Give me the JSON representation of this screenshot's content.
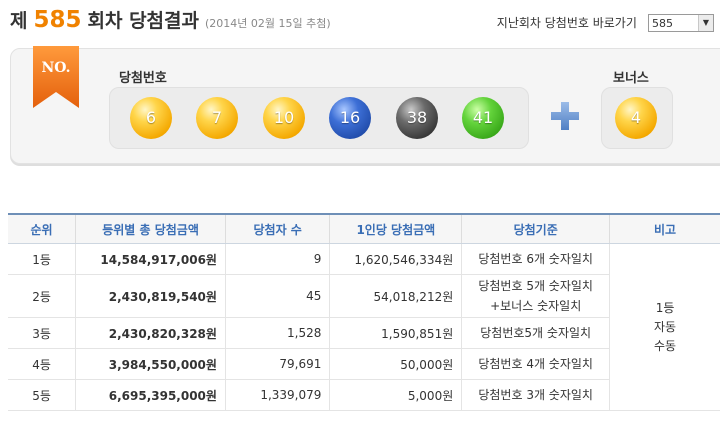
{
  "header": {
    "title_prefix": "제",
    "round": "585",
    "title_suffix": "회차 당첨결과",
    "draw_date": "(2014년 02월 15일 추첨)",
    "jump_label": "지난회차 당첨번호 바로가기",
    "jump_value": "585"
  },
  "result": {
    "badge": "NO.",
    "winning_label": "당첨번호",
    "numbers": [
      {
        "value": "6",
        "color": "yellow"
      },
      {
        "value": "7",
        "color": "yellow"
      },
      {
        "value": "10",
        "color": "yellow"
      },
      {
        "value": "16",
        "color": "blue"
      },
      {
        "value": "38",
        "color": "gray"
      },
      {
        "value": "41",
        "color": "green"
      }
    ],
    "bonus_label": "보너스",
    "bonus": {
      "value": "4",
      "color": "yellow"
    }
  },
  "table": {
    "headers": [
      "순위",
      "등위별 총 당첨금액",
      "당첨자 수",
      "1인당 당첨금액",
      "당첨기준",
      "비고"
    ],
    "rows": [
      {
        "rank": "1등",
        "total": "14,584,917,006원",
        "winners": "9",
        "per": "1,620,546,334원",
        "criteria": [
          "당첨번호 6개 숫자일치"
        ]
      },
      {
        "rank": "2등",
        "total": "2,430,819,540원",
        "winners": "45",
        "per": "54,018,212원",
        "criteria": [
          "당첨번호 5개 숫자일치",
          "+보너스 숫자일치"
        ]
      },
      {
        "rank": "3등",
        "total": "2,430,820,328원",
        "winners": "1,528",
        "per": "1,590,851원",
        "criteria": [
          "당첨번호5개 숫자일치"
        ]
      },
      {
        "rank": "4등",
        "total": "3,984,550,000원",
        "winners": "79,691",
        "per": "50,000원",
        "criteria": [
          "당첨번호 4개 숫자일치"
        ]
      },
      {
        "rank": "5등",
        "total": "6,695,395,000원",
        "winners": "1,339,079",
        "per": "5,000원",
        "criteria": [
          "당첨번호 3개 숫자일치"
        ]
      }
    ],
    "note_lines": [
      "1등",
      "자동",
      "수동"
    ]
  },
  "colors": {
    "accent_orange": "#f08200",
    "header_text_blue": "#3a6eb5",
    "ball_yellow": "#f4a800",
    "ball_blue": "#1f4aa8",
    "ball_gray": "#333333",
    "ball_green": "#35a416",
    "plus_blue": "#5b8ad1"
  },
  "icons": {
    "ribbon": "bookmark-ribbon-icon",
    "plus": "plus-icon",
    "dropdown": "chevron-down-icon"
  }
}
